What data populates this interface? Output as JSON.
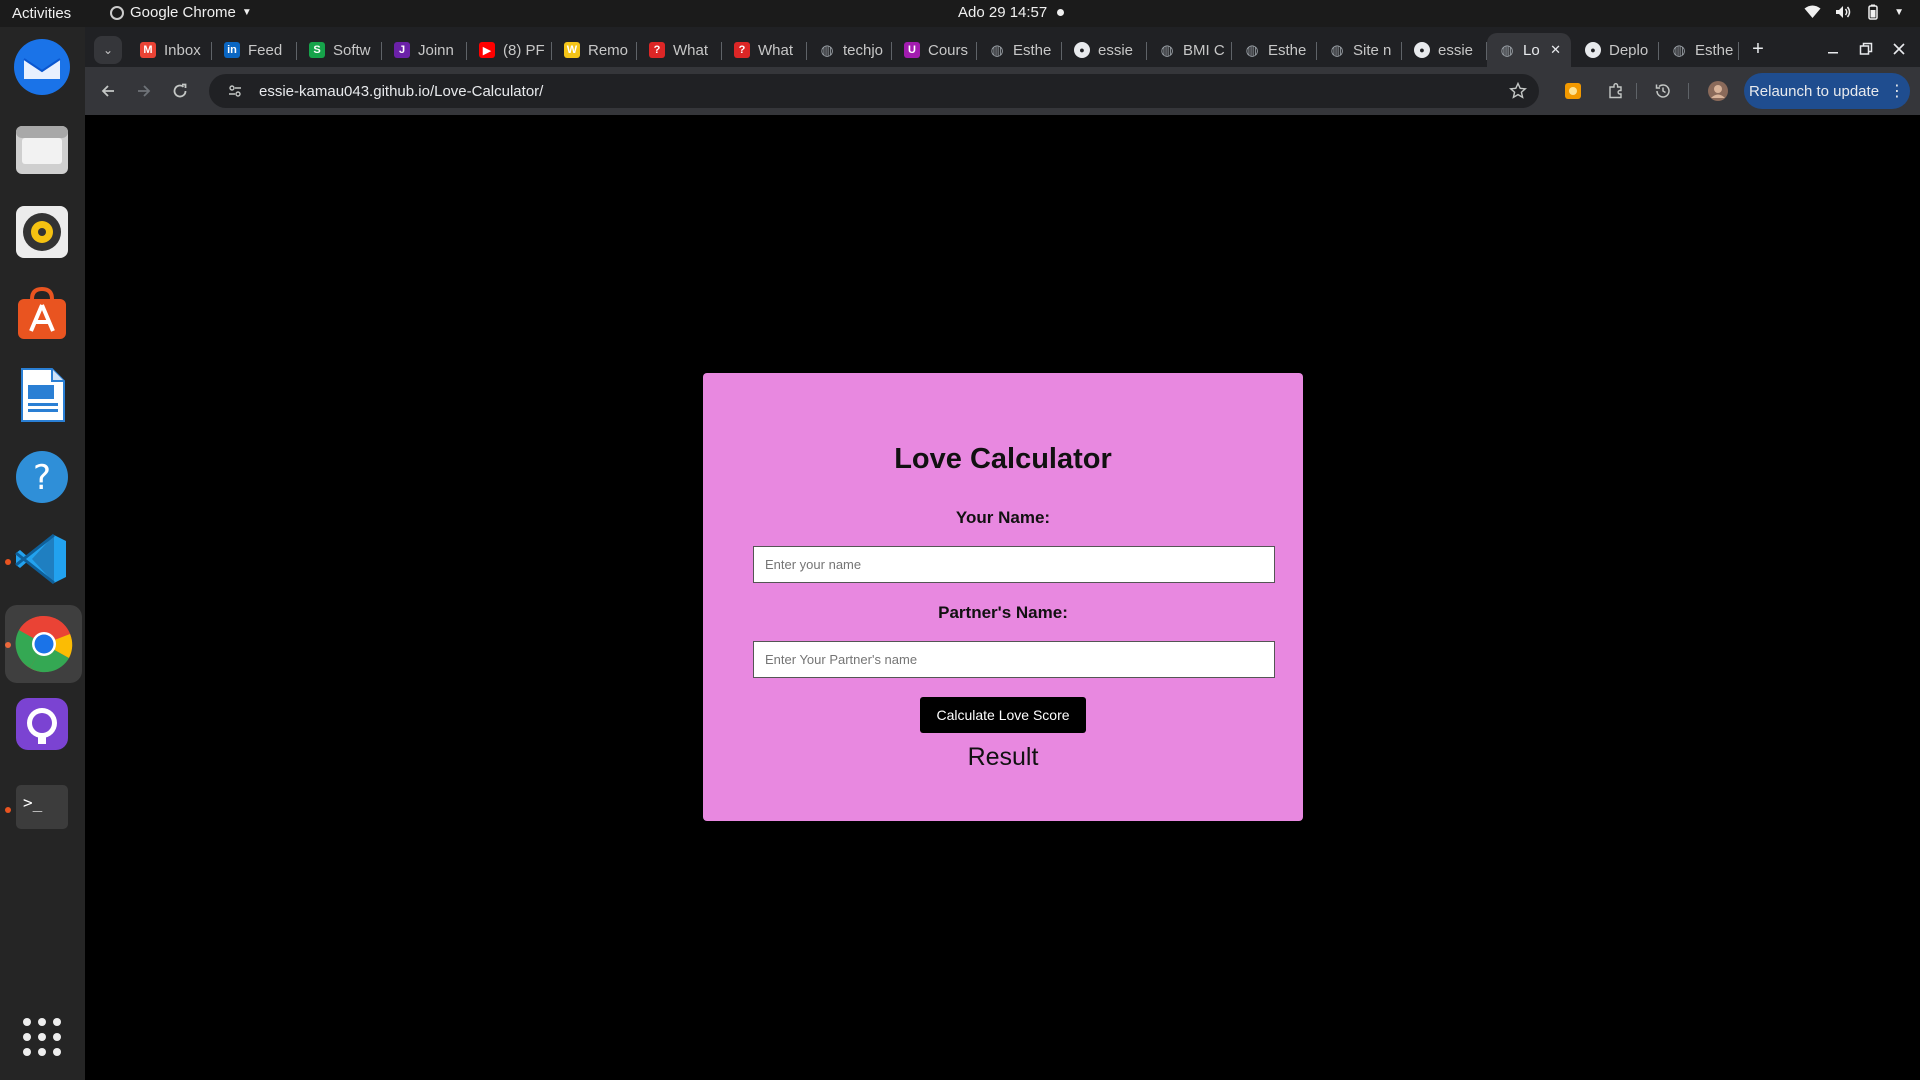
{
  "topbar": {
    "activities": "Activities",
    "app_name": "Google Chrome",
    "datetime": "Ado 29  14:57"
  },
  "tabs": [
    {
      "label": "Inbox",
      "icon": "gmail-icon",
      "color": "#ea4335"
    },
    {
      "label": "Feed",
      "icon": "linkedin-icon",
      "color": "#0a66c2"
    },
    {
      "label": "Softw",
      "icon": "softw-icon",
      "color": "#16a34a"
    },
    {
      "label": "Joinn",
      "icon": "joinn-icon",
      "color": "#6b21a8"
    },
    {
      "label": "(8) PF",
      "icon": "youtube-icon",
      "color": "#ff0000"
    },
    {
      "label": "Remo",
      "icon": "w-icon",
      "color": "#f5c518"
    },
    {
      "label": "What",
      "icon": "question-icon",
      "color": "#dc2626"
    },
    {
      "label": "What",
      "icon": "question-icon",
      "color": "#dc2626"
    },
    {
      "label": "techjo",
      "icon": "globe-icon",
      "color": "#9aa0a6"
    },
    {
      "label": "Cours",
      "icon": "course-icon",
      "color": "#a21caf"
    },
    {
      "label": "Esthe",
      "icon": "globe-icon",
      "color": "#9aa0a6"
    },
    {
      "label": "essie",
      "icon": "github-icon",
      "color": "#e8eaed"
    },
    {
      "label": "BMI C",
      "icon": "globe-icon",
      "color": "#9aa0a6"
    },
    {
      "label": "Esthe",
      "icon": "globe-icon",
      "color": "#9aa0a6"
    },
    {
      "label": "Site n",
      "icon": "globe-icon",
      "color": "#9aa0a6"
    },
    {
      "label": "essie",
      "icon": "github-icon",
      "color": "#e8eaed"
    },
    {
      "label": "Lo",
      "icon": "globe-icon",
      "color": "#9aa0a6",
      "active": true
    },
    {
      "label": "Deplo",
      "icon": "github-icon",
      "color": "#e8eaed"
    },
    {
      "label": "Esthe",
      "icon": "globe-icon",
      "color": "#9aa0a6"
    }
  ],
  "toolbar": {
    "url": "essie-kamau043.github.io/Love-Calculator/",
    "relaunch_label": "Relaunch to update"
  },
  "dock": [
    {
      "name": "thunderbird-icon",
      "color": "#1a73e8"
    },
    {
      "name": "files-icon",
      "color": "#cfcfcf"
    },
    {
      "name": "rhythmbox-icon",
      "color": "#f5c211"
    },
    {
      "name": "app-center-icon",
      "color": "#e95420"
    },
    {
      "name": "libreoffice-writer-icon",
      "color": "#2a7fd4"
    },
    {
      "name": "help-icon",
      "color": "#2f8fd8"
    },
    {
      "name": "vscode-icon",
      "color": "#22a2ef"
    },
    {
      "name": "chrome-icon",
      "color": "#34a853"
    },
    {
      "name": "github-desktop-icon",
      "color": "#7b43d2"
    },
    {
      "name": "terminal-icon",
      "color": "#3c3c3c"
    }
  ],
  "page": {
    "title": "Love Calculator",
    "your_name_label": "Your Name:",
    "your_name_placeholder": "Enter your name",
    "partner_name_label": "Partner's Name:",
    "partner_name_placeholder": "Enter Your Partner's name",
    "calculate_label": "Calculate Love Score",
    "result": "Result",
    "card_color": "#e888e0"
  }
}
